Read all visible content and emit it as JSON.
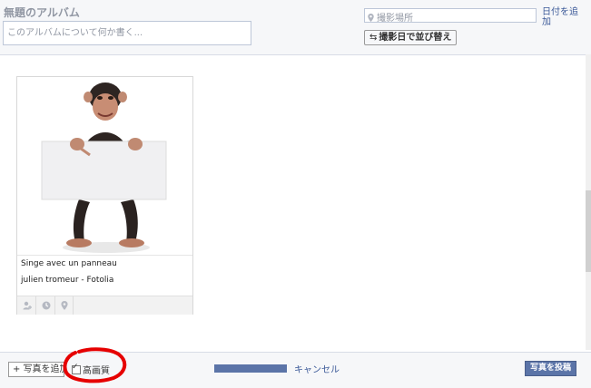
{
  "header": {
    "album_title": "無題のアルバム",
    "description_placeholder": "このアルバムについて何か書く...",
    "location_placeholder": "撮影場所",
    "date_link": "日付を追加",
    "sort_button": "撮影日で並び替え"
  },
  "photo_card": {
    "caption_title": "Singe avec un panneau",
    "caption_credit": "julien tromeur - Fotolia",
    "footer_icons": [
      "tag-person-icon",
      "clock-icon",
      "location-pin-icon"
    ]
  },
  "footer": {
    "add_photos_label": "+ 写真を追加",
    "high_quality_label": "高画質",
    "high_quality_checked": true,
    "upload_progress_percent": 100,
    "cancel_label": "キャンセル",
    "post_label": "写真を投稿"
  },
  "colors": {
    "link": "#3b5998",
    "primary_button": "#5b74a8",
    "annotation_circle": "#e60000"
  }
}
